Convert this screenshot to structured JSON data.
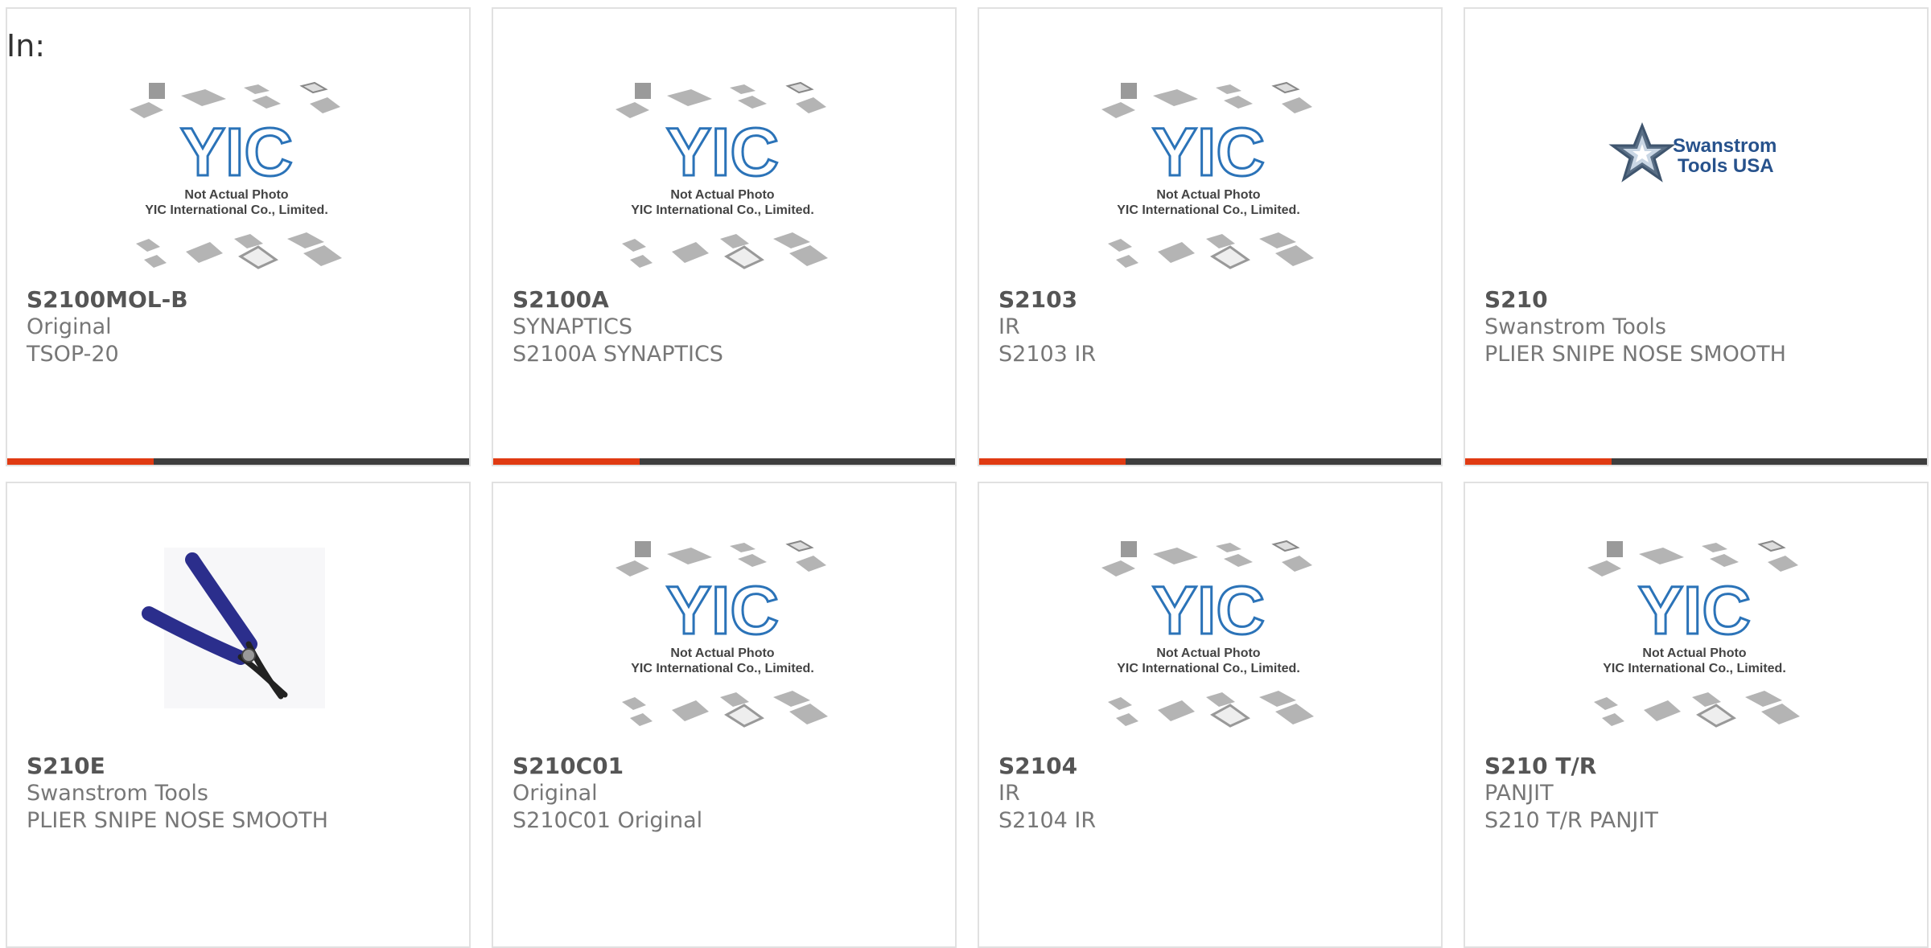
{
  "header": {
    "label": "In:"
  },
  "placeholder": {
    "line1": "Not Actual Photo",
    "line2": "YIC International Co., Limited.",
    "logo": "YIC"
  },
  "swanstrom_logo": {
    "line1": "Swanstrom",
    "line2": "Tools USA"
  },
  "colors": {
    "accent": "#e03a12",
    "bar": "#3e3e3e",
    "yic_blue": "#2b73b8",
    "plier_handle": "#2b2e8c"
  },
  "products": [
    {
      "part": "S2100MOL-B",
      "maker": "Original",
      "desc": "TSOP-20",
      "image": "yic-placeholder"
    },
    {
      "part": "S2100A",
      "maker": "SYNAPTICS",
      "desc": "S2100A SYNAPTICS",
      "image": "yic-placeholder"
    },
    {
      "part": "S2103",
      "maker": "IR",
      "desc": "S2103 IR",
      "image": "yic-placeholder"
    },
    {
      "part": "S210",
      "maker": "Swanstrom Tools",
      "desc": "PLIER SNIPE NOSE SMOOTH",
      "image": "swanstrom-logo"
    },
    {
      "part": "S210E",
      "maker": "Swanstrom Tools",
      "desc": "PLIER SNIPE NOSE SMOOTH",
      "image": "plier-photo"
    },
    {
      "part": "S210C01",
      "maker": "Original",
      "desc": "S210C01 Original",
      "image": "yic-placeholder"
    },
    {
      "part": "S2104",
      "maker": "IR",
      "desc": "S2104 IR",
      "image": "yic-placeholder"
    },
    {
      "part": "S210 T/R",
      "maker": "PANJIT",
      "desc": "S210 T/R PANJIT",
      "image": "yic-placeholder"
    }
  ]
}
